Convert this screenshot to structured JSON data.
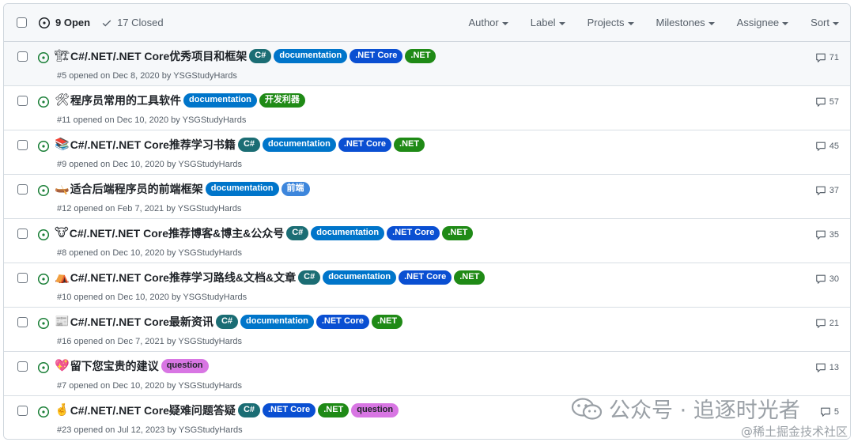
{
  "header": {
    "open_label": "9 Open",
    "closed_label": "17 Closed",
    "filters": [
      "Author",
      "Label",
      "Projects",
      "Milestones",
      "Assignee",
      "Sort"
    ]
  },
  "label_styles": {
    "C#": {
      "bg": "#1b6d74",
      "fg": "#ffffff"
    },
    "documentation": {
      "bg": "#0075ca",
      "fg": "#ffffff"
    },
    ".NET Core": {
      "bg": "#0a4fd2",
      "fg": "#ffffff"
    },
    ".NET": {
      "bg": "#1f8a16",
      "fg": "#ffffff"
    },
    "开发利器": {
      "bg": "#1f8a16",
      "fg": "#ffffff"
    },
    "前端": {
      "bg": "#3d86dc",
      "fg": "#ffffff"
    },
    "question": {
      "bg": "#d876e3",
      "fg": "#1f2328"
    }
  },
  "open_icon_color": "#1a7f37",
  "issues": [
    {
      "emoji": "🏗",
      "title": "C#/.NET/.NET Core优秀项目和框架",
      "labels": [
        "C#",
        "documentation",
        ".NET Core",
        ".NET"
      ],
      "meta": "#5 opened on Dec 8, 2020 by YSGStudyHards",
      "comments": "71"
    },
    {
      "emoji": "🛠",
      "title": "程序员常用的工具软件",
      "labels": [
        "documentation",
        "开发利器"
      ],
      "meta": "#11 opened on Dec 10, 2020 by YSGStudyHards",
      "comments": "57"
    },
    {
      "emoji": "📚",
      "title": "C#/.NET/.NET Core推荐学习书籍",
      "labels": [
        "C#",
        "documentation",
        ".NET Core",
        ".NET"
      ],
      "meta": "#9 opened on Dec 10, 2020 by YSGStudyHards",
      "comments": "45"
    },
    {
      "emoji": "🛶",
      "title": "适合后端程序员的前端框架",
      "labels": [
        "documentation",
        "前端"
      ],
      "meta": "#12 opened on Feb 7, 2021 by YSGStudyHards",
      "comments": "37"
    },
    {
      "emoji": "🐮",
      "title": "C#/.NET/.NET Core推荐博客&博主&公众号",
      "labels": [
        "C#",
        "documentation",
        ".NET Core",
        ".NET"
      ],
      "meta": "#8 opened on Dec 10, 2020 by YSGStudyHards",
      "comments": "35"
    },
    {
      "emoji": "⛺",
      "title": "C#/.NET/.NET Core推荐学习路线&文档&文章",
      "labels": [
        "C#",
        "documentation",
        ".NET Core",
        ".NET"
      ],
      "meta": "#10 opened on Dec 10, 2020 by YSGStudyHards",
      "comments": "30"
    },
    {
      "emoji": "📰",
      "title": "C#/.NET/.NET Core最新资讯",
      "labels": [
        "C#",
        "documentation",
        ".NET Core",
        ".NET"
      ],
      "meta": "#16 opened on Dec 7, 2021 by YSGStudyHards",
      "comments": "21"
    },
    {
      "emoji": "💖",
      "title": "留下您宝贵的建议",
      "labels": [
        "question"
      ],
      "meta": "#7 opened on Dec 10, 2020 by YSGStudyHards",
      "comments": "13"
    },
    {
      "emoji": "🤞",
      "title": "C#/.NET/.NET Core疑难问题答疑",
      "labels": [
        "C#",
        ".NET Core",
        ".NET",
        "question"
      ],
      "meta": "#23 opened on Jul 12, 2023 by YSGStudyHards",
      "comments": "5"
    }
  ],
  "watermark": {
    "line1": "公众号 · 追逐时光者",
    "line2": "@稀土掘金技术社区"
  }
}
